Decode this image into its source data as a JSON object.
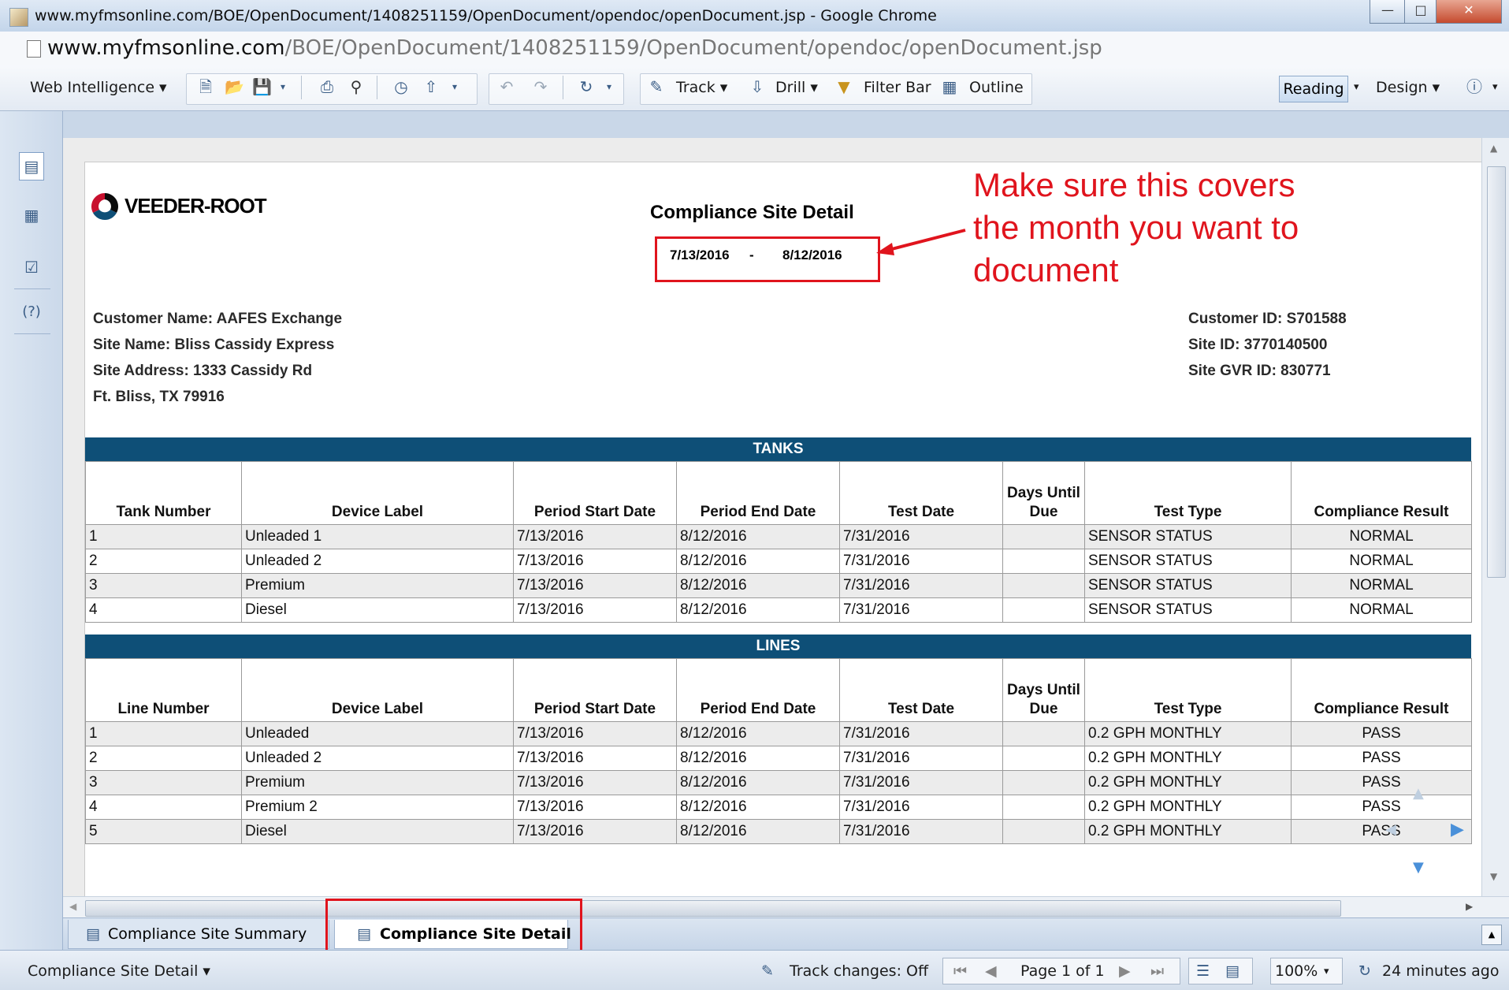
{
  "window": {
    "title": "www.myfmsonline.com/BOE/OpenDocument/1408251159/OpenDocument/opendoc/openDocument.jsp - Google Chrome",
    "url_domain": "www.myfmsonline.com",
    "url_path": "/BOE/OpenDocument/1408251159/OpenDocument/opendoc/openDocument.jsp"
  },
  "toolbar": {
    "app_menu": "Web Intelligence",
    "track": "Track",
    "drill": "Drill",
    "filter_bar": "Filter Bar",
    "outline": "Outline",
    "reading": "Reading",
    "design": "Design"
  },
  "report": {
    "logo_text": "VEEDER-ROOT",
    "title": "Compliance Site Detail",
    "period_start": "7/13/2016",
    "period_sep": "-",
    "period_end": "8/12/2016",
    "customer_name": "Customer Name: AAFES Exchange",
    "site_name": "Site Name: Bliss Cassidy Express",
    "site_address": "Site Address: 1333 Cassidy Rd",
    "site_city": "Ft. Bliss, TX 79916",
    "customer_id": "Customer ID: S701588",
    "site_id": "Site ID: 3770140500",
    "site_gvr_id": "Site GVR ID: 830771"
  },
  "annotation": {
    "line1": "Make sure this covers",
    "line2": "the month you want to",
    "line3": "document"
  },
  "tanks": {
    "title": "TANKS",
    "headers": [
      "Tank Number",
      "Device Label",
      "Period Start Date",
      "Period End Date",
      "Test Date",
      "Days Until Due",
      "Test Type",
      "Compliance Result"
    ],
    "rows": [
      [
        "1",
        "Unleaded 1",
        "7/13/2016",
        "8/12/2016",
        "7/31/2016",
        "",
        "SENSOR STATUS",
        "NORMAL"
      ],
      [
        "2",
        "Unleaded 2",
        "7/13/2016",
        "8/12/2016",
        "7/31/2016",
        "",
        "SENSOR STATUS",
        "NORMAL"
      ],
      [
        "3",
        "Premium",
        "7/13/2016",
        "8/12/2016",
        "7/31/2016",
        "",
        "SENSOR STATUS",
        "NORMAL"
      ],
      [
        "4",
        "Diesel",
        "7/13/2016",
        "8/12/2016",
        "7/31/2016",
        "",
        "SENSOR STATUS",
        "NORMAL"
      ]
    ]
  },
  "lines": {
    "title": "LINES",
    "headers": [
      "Line Number",
      "Device Label",
      "Period Start Date",
      "Period End Date",
      "Test Date",
      "Days Until Due",
      "Test Type",
      "Compliance Result"
    ],
    "rows": [
      [
        "1",
        "Unleaded",
        "7/13/2016",
        "8/12/2016",
        "7/31/2016",
        "",
        "0.2 GPH MONTHLY",
        "PASS"
      ],
      [
        "2",
        "Unleaded 2",
        "7/13/2016",
        "8/12/2016",
        "7/31/2016",
        "",
        "0.2 GPH MONTHLY",
        "PASS"
      ],
      [
        "3",
        "Premium",
        "7/13/2016",
        "8/12/2016",
        "7/31/2016",
        "",
        "0.2 GPH MONTHLY",
        "PASS"
      ],
      [
        "4",
        "Premium 2",
        "7/13/2016",
        "8/12/2016",
        "7/31/2016",
        "",
        "0.2 GPH MONTHLY",
        "PASS"
      ],
      [
        "5",
        "Diesel",
        "7/13/2016",
        "8/12/2016",
        "7/31/2016",
        "",
        "0.2 GPH MONTHLY",
        "PASS"
      ]
    ]
  },
  "report_tabs": [
    "Compliance Site Summary",
    "Compliance Site Detail"
  ],
  "status": {
    "report_selector": "Compliance Site Detail",
    "track_changes": "Track changes: Off",
    "page": "Page 1 of 1",
    "zoom": "100%",
    "refreshed": "24 minutes ago"
  },
  "colors": {
    "section_bar": "#0e4f77",
    "annotation": "#e0141d",
    "logo_red": "#c8102e"
  }
}
